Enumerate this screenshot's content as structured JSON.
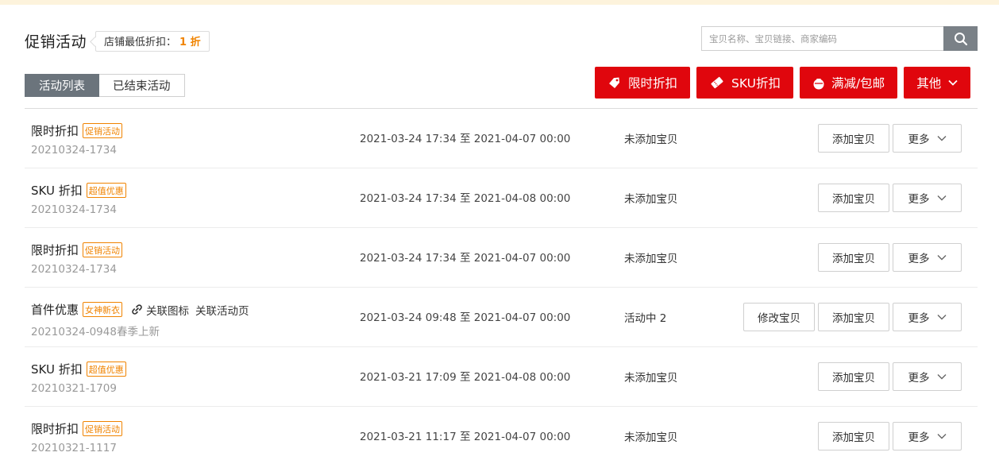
{
  "header": {
    "title": "促销活动",
    "discount_label": "店铺最低折扣：",
    "discount_value": "1 折"
  },
  "search": {
    "placeholder": "宝贝名称、宝贝链接、商家编码"
  },
  "tabs": [
    {
      "label": "活动列表",
      "active": true
    },
    {
      "label": "已结束活动",
      "active": false
    }
  ],
  "actions": {
    "limited_discount": "限时折扣",
    "sku_discount": "SKU折扣",
    "full_reduction": "满减/包邮",
    "other": "其他"
  },
  "colors": {
    "accent_red": "#e0060d",
    "tag_orange": "#f08300",
    "tab_active": "#6b747c"
  },
  "rows": [
    {
      "name": "限时折扣",
      "tag": "促销活动",
      "id": "20210324-1734",
      "time": "2021-03-24 17:34 至 2021-04-07 00:00",
      "status": "未添加宝贝",
      "add": "添加宝贝",
      "more": "更多"
    },
    {
      "name": "SKU 折扣",
      "tag": "超值优惠",
      "id": "20210324-1734",
      "time": "2021-03-24 17:34 至 2021-04-08 00:00",
      "status": "未添加宝贝",
      "add": "添加宝贝",
      "more": "更多"
    },
    {
      "name": "限时折扣",
      "tag": "促销活动",
      "id": "20210324-1734",
      "time": "2021-03-24 17:34 至 2021-04-07 00:00",
      "status": "未添加宝贝",
      "add": "添加宝贝",
      "more": "更多"
    },
    {
      "name": "首件优惠",
      "tag": "女神新衣",
      "link_icon": "关联图标",
      "link_page": "关联活动页",
      "id": "20210324-0948春季上新",
      "time": "2021-03-24 09:48 至 2021-04-07 00:00",
      "status": "活动中 2",
      "edit": "修改宝贝",
      "add": "添加宝贝",
      "more": "更多"
    },
    {
      "name": "SKU 折扣",
      "tag": "超值优惠",
      "id": "20210321-1709",
      "time": "2021-03-21 17:09 至 2021-04-08 00:00",
      "status": "未添加宝贝",
      "add": "添加宝贝",
      "more": "更多"
    },
    {
      "name": "限时折扣",
      "tag": "促销活动",
      "id": "20210321-1117",
      "time": "2021-03-21 11:17 至 2021-04-07 00:00",
      "status": "未添加宝贝",
      "add": "添加宝贝",
      "more": "更多"
    }
  ]
}
